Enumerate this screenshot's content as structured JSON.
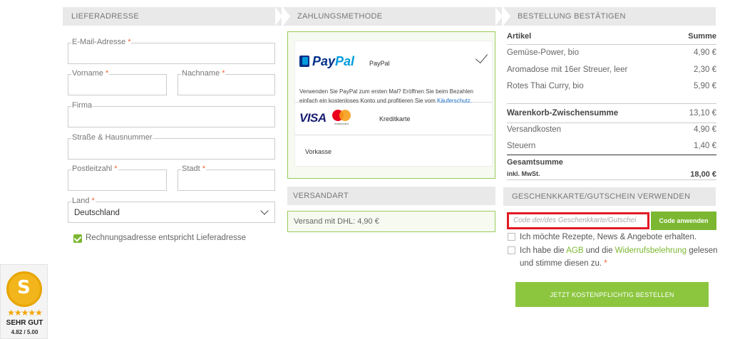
{
  "steps": {
    "delivery": "LIEFERADRESSE",
    "payment": "ZAHLUNGSMETHODE",
    "confirm": "BESTELLUNG BESTÄTIGEN"
  },
  "address_form": {
    "email": "E-Mail-Adresse",
    "firstname": "Vorname",
    "lastname": "Nachname",
    "company": "Firma",
    "street": "Straße & Hausnummer",
    "zip": "Postleitzahl",
    "city": "Stadt",
    "country_label": "Land",
    "country_value": "Deutschland",
    "required_mark": "*",
    "billing_same_label": "Rechnungsadresse entspricht Lieferadresse"
  },
  "payment": {
    "paypal_logo_a": "Pay",
    "paypal_logo_b": "Pal",
    "paypal_name": "PayPal",
    "paypal_desc": "Verwenden Sie PayPal zum ersten Mal? Eröffnen Sie beim Bezahlen einfach ein kostenloses Konto und profitieren Sie vom",
    "paypal_link": "Käuferschutz.",
    "visa_logo": "VISA",
    "mastercard_text": "mastercard",
    "card_name": "Kreditkarte",
    "prepay_name": "Vorkasse"
  },
  "shipping": {
    "header": "VERSANDART",
    "option": "Versand mit DHL: 4,90 €"
  },
  "summary": {
    "col_article": "Artikel",
    "col_sum": "Summe",
    "items": [
      {
        "name": "Gemüse-Power, bio",
        "price": "4,90 €"
      },
      {
        "name": "Aromadose mit 16er Streuer, leer",
        "price": "2,30 €"
      },
      {
        "name": "Rotes Thai Curry, bio",
        "price": "5,90 €"
      }
    ],
    "subtotal_label": "Warenkorb-Zwischensumme",
    "subtotal": "13,10 €",
    "shipping_label": "Versandkosten",
    "shipping": "4,90 €",
    "tax_label": "Steuern",
    "tax": "1,40 €",
    "total_label": "Gesamtsumme",
    "total_sub": "inkl. MwSt.",
    "total": "18,00 €"
  },
  "voucher": {
    "header": "GESCHENKKARTE/GUTSCHEIN VERWENDEN",
    "placeholder": "Code der/des Geschenkkarte/Gutschei",
    "button": "Code anwenden"
  },
  "consent": {
    "newsletter": "Ich möchte Rezepte, News & Angebote erhalten.",
    "terms_a": "Ich habe die",
    "terms_agb": "AGB",
    "terms_b": "und die",
    "terms_withdrawal": "Widerrufsbelehrung",
    "terms_c": "gelesen und stimme diesen zu.",
    "required_mark": "*"
  },
  "order_button": "JETZT KOSTENPFLICHTIG BESTELLEN",
  "seal": {
    "stars": "★★★★★",
    "rating": "SEHR GUT",
    "score": "4.82 / 5.00"
  },
  "colors": {
    "accent": "#7bb731",
    "error_border": "#e01b24"
  }
}
